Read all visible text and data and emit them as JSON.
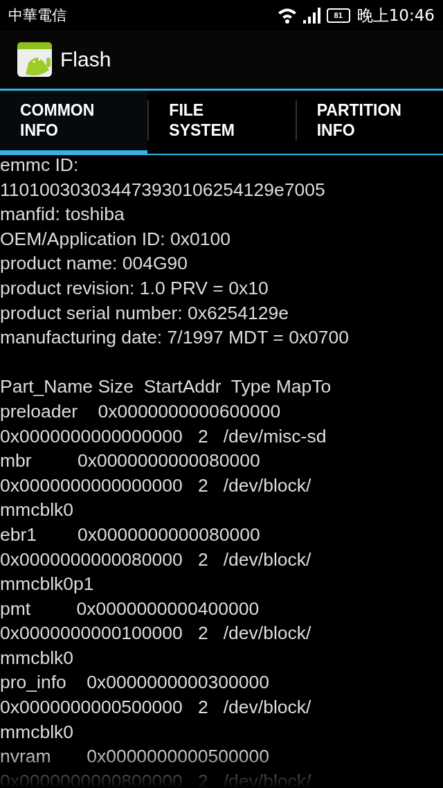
{
  "status_bar": {
    "carrier": "中華電信",
    "battery": "81",
    "time": "晚上10:46"
  },
  "action_bar": {
    "title": "Flash"
  },
  "tabs": [
    {
      "label": "COMMON\nINFO",
      "selected": true
    },
    {
      "label": "FILE\nSYSTEM",
      "selected": false
    },
    {
      "label": "PARTITION\nINFO",
      "selected": false
    }
  ],
  "emmc_info": [
    "emmc ID:",
    "110100303034473930106254129e7005",
    "manfid: toshiba",
    "OEM/Application ID: 0x0100",
    "product name: 004G90",
    "product revision: 1.0 PRV = 0x10",
    "product serial number: 0x6254129e",
    "manufacturing date: 7/1997 MDT = 0x0700"
  ],
  "partition_table": [
    "Part_Name Size  StartAddr  Type MapTo",
    "preloader    0x0000000000600000",
    "0x0000000000000000   2   /dev/misc-sd",
    "mbr         0x0000000000080000",
    "0x0000000000000000   2   /dev/block/",
    "mmcblk0",
    "ebr1        0x0000000000080000",
    "0x0000000000080000   2   /dev/block/",
    "mmcblk0p1",
    "pmt         0x0000000000400000",
    "0x0000000000100000   2   /dev/block/",
    "mmcblk0",
    "pro_info    0x0000000000300000",
    "0x0000000000500000   2   /dev/block/",
    "mmcblk0",
    "nvram       0x0000000000500000",
    "0x0000000000800000   2   /dev/block/"
  ]
}
